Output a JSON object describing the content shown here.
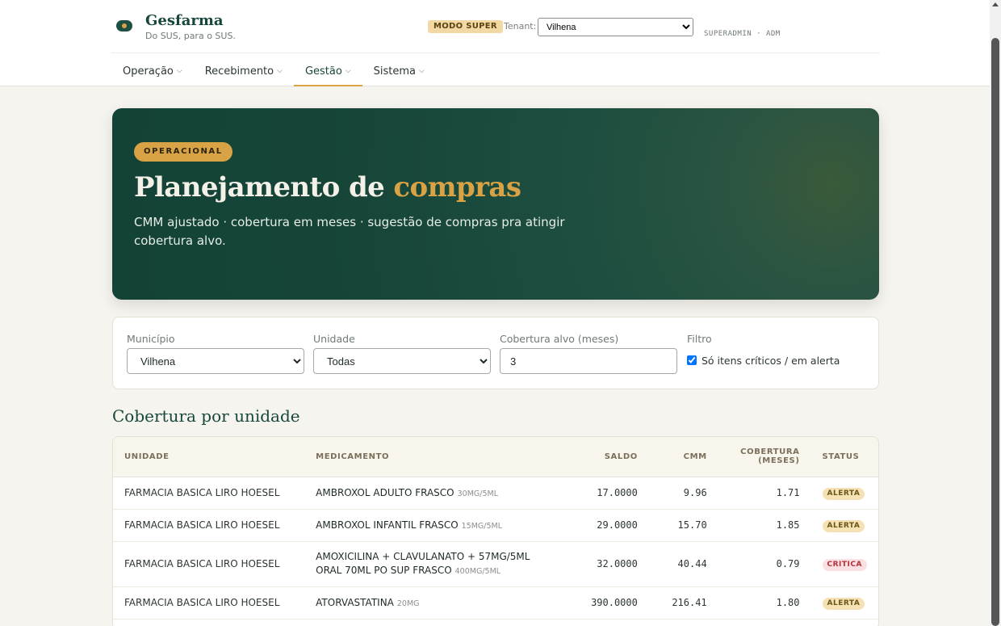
{
  "header": {
    "brand_name": "Gesfarma",
    "brand_tagline": "Do SUS, para o SUS.",
    "mode_badge": "MODO SUPER",
    "tenant_label": "Tenant:",
    "tenant_value": "Vilhena",
    "user_info": "SUPERADMIN · ADM"
  },
  "nav": {
    "items": [
      {
        "label": "Operação"
      },
      {
        "label": "Recebimento"
      },
      {
        "label": "Gestão"
      },
      {
        "label": "Sistema"
      }
    ]
  },
  "hero": {
    "badge": "OPERACIONAL",
    "title_main": "Planejamento de ",
    "title_accent": "compras",
    "subtitle": "CMM ajustado · cobertura em meses · sugestão de compras pra atingir cobertura alvo."
  },
  "filters": {
    "municipio_label": "Município",
    "municipio_value": "Vilhena",
    "unidade_label": "Unidade",
    "unidade_value": "Todas",
    "cobertura_label": "Cobertura alvo (meses)",
    "cobertura_value": "3",
    "filtro_label": "Filtro",
    "filtro_check_label": "Só itens críticos / em alerta"
  },
  "section": {
    "title": "Cobertura por unidade"
  },
  "table": {
    "headers": {
      "unidade": "UNIDADE",
      "medicamento": "MEDICAMENTO",
      "saldo": "SALDO",
      "cmm": "CMM",
      "cobertura_1": "COBERTURA",
      "cobertura_2": "(MESES)",
      "status": "STATUS"
    },
    "rows": [
      {
        "unidade": "FARMACIA BASICA LIRO HOESEL",
        "medicamento": "AMBROXOL ADULTO FRASCO",
        "dose": "30MG/5ML",
        "saldo": "17.0000",
        "cmm": "9.96",
        "cobertura": "1.71",
        "status": "ALERTA"
      },
      {
        "unidade": "FARMACIA BASICA LIRO HOESEL",
        "medicamento": "AMBROXOL INFANTIL FRASCO",
        "dose": "15MG/5ML",
        "saldo": "29.0000",
        "cmm": "15.70",
        "cobertura": "1.85",
        "status": "ALERTA"
      },
      {
        "unidade": "FARMACIA BASICA LIRO HOESEL",
        "medicamento": "AMOXICILINA + CLAVULANATO + 57MG/5ML ORAL 70ML PO SUP FRASCO",
        "dose": "400MG/5ML",
        "saldo": "32.0000",
        "cmm": "40.44",
        "cobertura": "0.79",
        "status": "CRITICA"
      },
      {
        "unidade": "FARMACIA BASICA LIRO HOESEL",
        "medicamento": "ATORVASTATINA",
        "dose": "20MG",
        "saldo": "390.0000",
        "cmm": "216.41",
        "cobertura": "1.80",
        "status": "ALERTA"
      }
    ]
  }
}
